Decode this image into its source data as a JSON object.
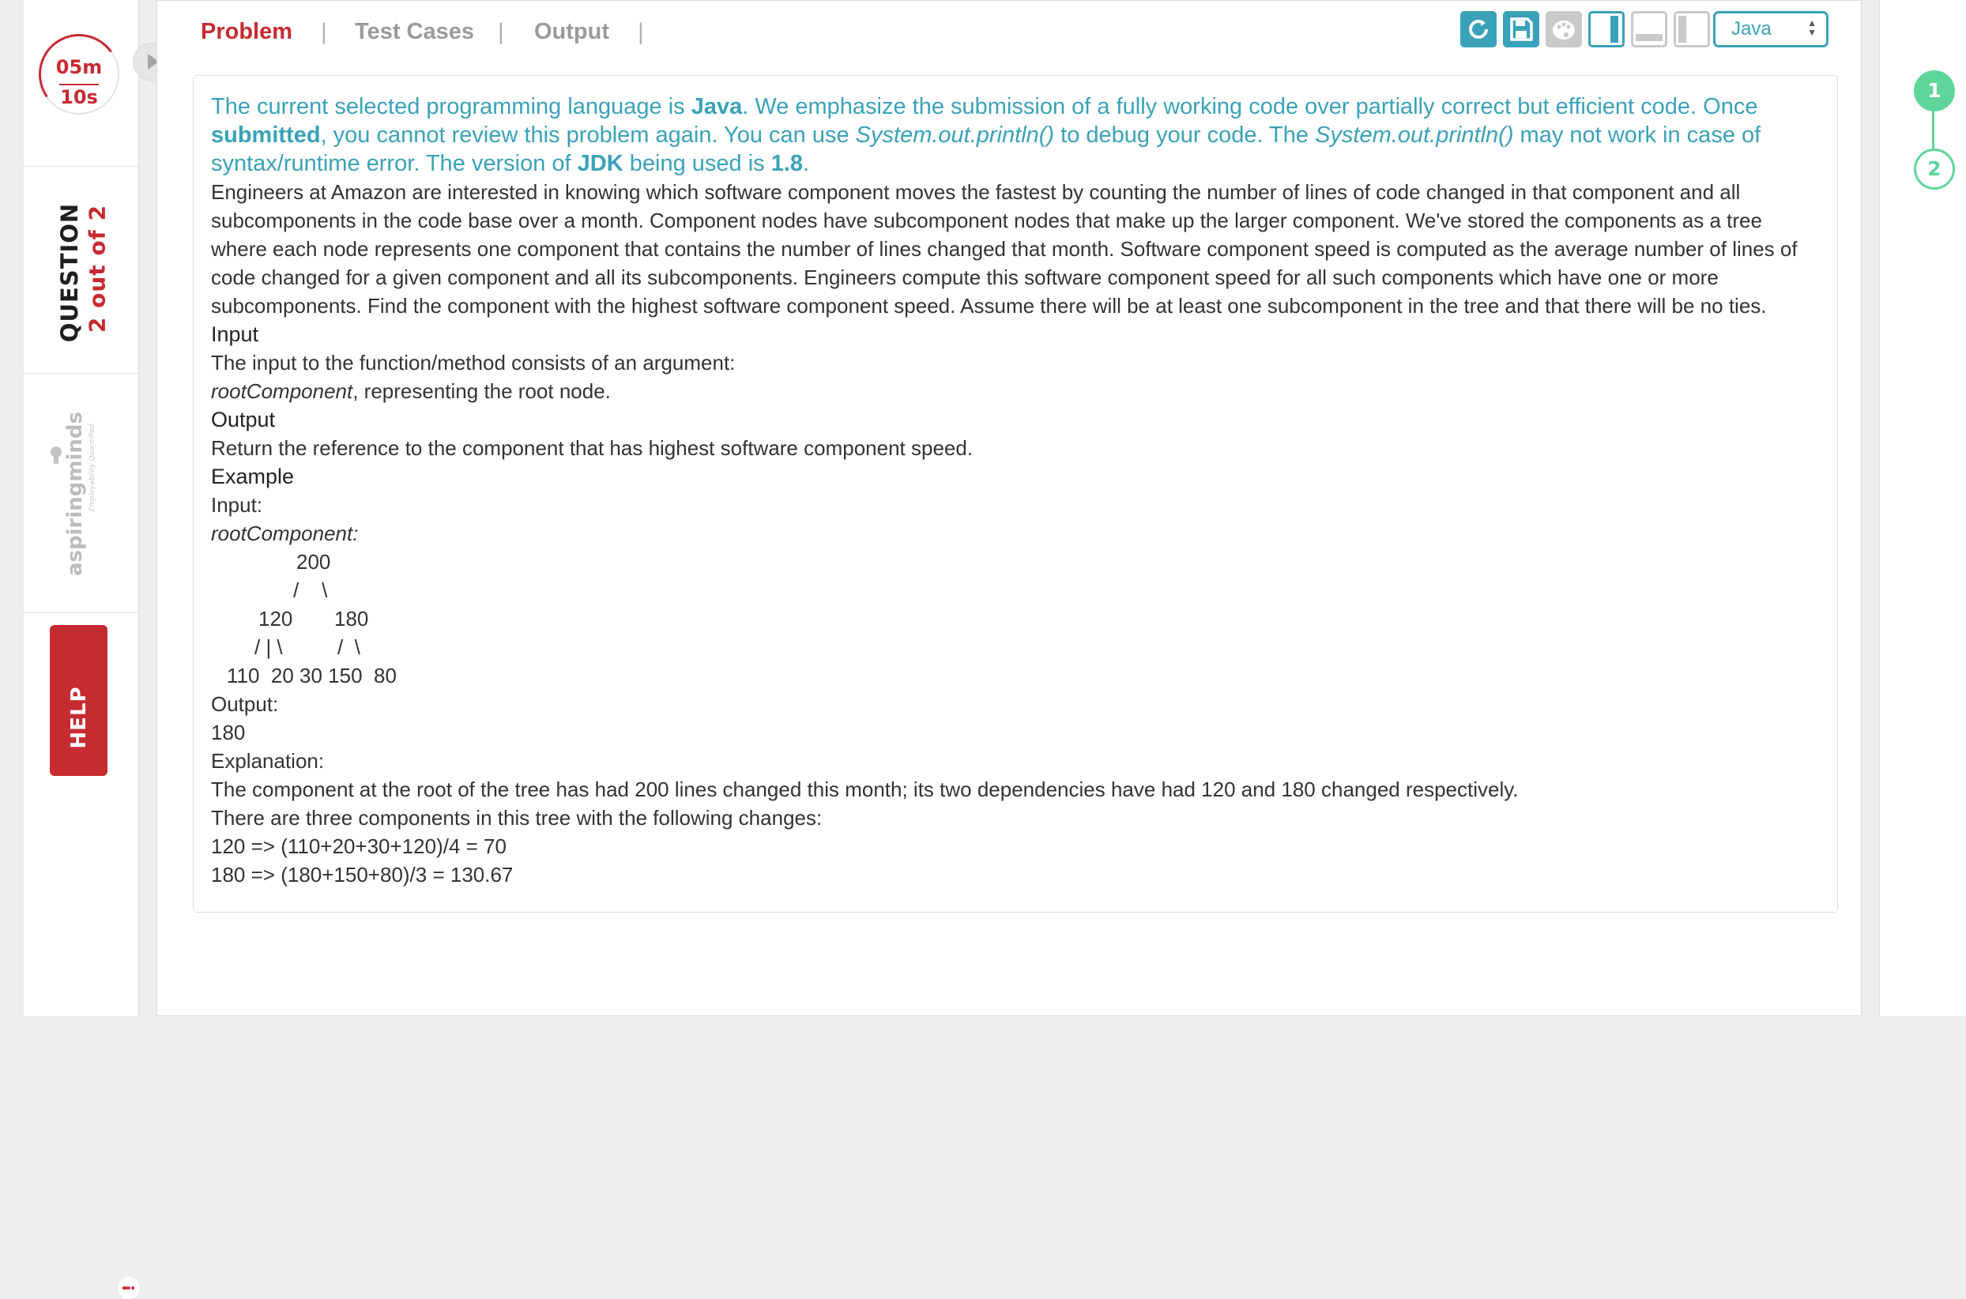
{
  "timer": {
    "minutes": "05m",
    "seconds": "10s"
  },
  "question": {
    "label": "QUESTION",
    "count": "2 out of 2"
  },
  "brand": {
    "name": "aspiringminds",
    "tagline": "Employability Quantified"
  },
  "help": {
    "label": "HELP"
  },
  "tabs": [
    {
      "label": "Problem",
      "active": true
    },
    {
      "label": "Test Cases",
      "active": false
    },
    {
      "label": "Output",
      "active": false
    }
  ],
  "toolbar": {
    "language": "Java"
  },
  "notice": {
    "t1": "The current selected programming language is ",
    "lang": "Java",
    "t2": ". We emphasize the submission of a fully working code over partially correct but efficient code. Once ",
    "submitted": "submitted",
    "t3": ", you cannot review this problem again. You can use ",
    "println1": "System.out.println()",
    "t4": " to debug your code. The ",
    "println2": "System.out.println()",
    "t5": " may not work in case of syntax/runtime error. The version of ",
    "jdk": "JDK",
    "t6": " being used is ",
    "version": "1.8",
    "t7": "."
  },
  "problem": {
    "description": "Engineers at Amazon are interested in knowing which software component moves the fastest by counting the number of lines of code changed in that component and all subcomponents in the code base over a month. Component nodes have subcomponent nodes that make up the larger component. We've stored the components as a tree where each node represents one component that contains the number of lines changed that month. Software component speed is computed as the average number of lines of code changed for a given component and all its subcomponents. Engineers compute this software component speed for all such components which have one or more subcomponents. Find the component with the highest software component speed. Assume there will be at least one subcomponent in the tree and that there will be no ties.",
    "input_heading": "Input",
    "input_text": "The input to the function/method consists of an argument:",
    "input_param": "rootComponent",
    "input_param_desc": ", representing the root node.",
    "output_heading": "Output",
    "output_text": "Return the reference to the component that has highest software component speed.",
    "example_heading": "Example",
    "ex_input_label": "Input:",
    "ex_param_label": "rootComponent:",
    "tree": {
      "r1": "200",
      "r2": "/    \\",
      "r3a": "120",
      "r3b": "180",
      "r4a": "/ | \\",
      "r4b": "/  \\",
      "r5": "110  20 30 150  80"
    },
    "ex_output_label": "Output:",
    "ex_output_value": "180",
    "explanation_label": "Explanation:",
    "explanation_1": "The component at the root of the tree has had 200 lines changed this month; its two dependencies have had 120 and 180 changed respectively.",
    "explanation_2": "There are three components in this tree with the following changes:",
    "calc_1": "120 => (110+20+30+120)/4 = 70",
    "calc_2": "180 => (180+150+80)/3 = 130.67"
  },
  "steps": [
    {
      "label": "1"
    },
    {
      "label": "2"
    }
  ],
  "colors": {
    "accent": "#3aa2b8",
    "brand_red": "#c62b31",
    "step_green": "#5fd59a"
  }
}
